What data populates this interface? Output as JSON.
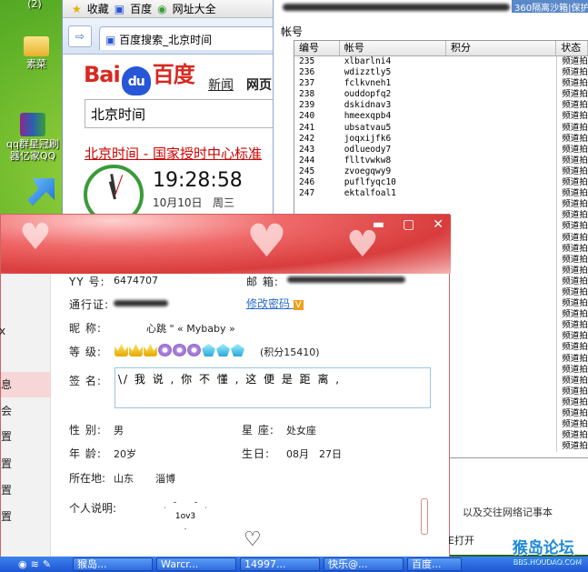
{
  "desktop": {
    "icons": [
      {
        "label": "(2)",
        "top": "-2"
      },
      {
        "label": "素菜"
      },
      {
        "label": "qq群星冠刷器亿家QQ"
      }
    ]
  },
  "browser": {
    "bookmarks": [
      "收藏",
      "百度",
      "网址大全"
    ],
    "tab_title": "百度搜索_北京时间",
    "logo": {
      "bai": "Bai",
      "du": "du",
      "baidu": "百度"
    },
    "nav_news": "新闻",
    "nav_web": "网页",
    "search_value": "北京时间",
    "result_link": "北京时间",
    "result_rest": " - 国家授时中心标准",
    "time": "19:28:58",
    "date": "10月10日",
    "weekday": "周三"
  },
  "accounts": {
    "top_right": "360隔离沙箱|保护",
    "section_title": "帐号",
    "columns": [
      "编号",
      "帐号",
      "积分",
      "状态"
    ],
    "rows": [
      {
        "id": "235",
        "account": "xlbarlni4"
      },
      {
        "id": "236",
        "account": "wdizztly5"
      },
      {
        "id": "237",
        "account": "fclkvneh1"
      },
      {
        "id": "238",
        "account": "ouddopfq2"
      },
      {
        "id": "239",
        "account": "dskidnav3"
      },
      {
        "id": "240",
        "account": "hmeexqpb4"
      },
      {
        "id": "241",
        "account": "ubsatvau5"
      },
      {
        "id": "242",
        "account": "joqxijfk6"
      },
      {
        "id": "243",
        "account": "odlueody7"
      },
      {
        "id": "244",
        "account": "flltvwkw8"
      },
      {
        "id": "245",
        "account": "zvoegqwy9"
      },
      {
        "id": "246",
        "account": "puflfyqc10"
      },
      {
        "id": "247",
        "account": "ektalfoal1"
      }
    ],
    "status_value": "频道拍",
    "bottom_text": "以及交往网络记事本"
  },
  "profile": {
    "yy_label": "YY 号:",
    "yy_value": "6474707",
    "email_label": "邮 箱:",
    "pass_label": "通行证:",
    "modify_password": "修改密码",
    "v_badge": "V",
    "nick_label": "昵 称:",
    "nick_value": "心跳 \" « Mybaby »",
    "level_label": "等 级:",
    "points": "(积分15410)",
    "sign_label": "签 名:",
    "sign_value": "\\/ 我 说 , 你 不 懂 , 这 便 是 距 离 ,",
    "gender_label": "性 别:",
    "gender_value": "男",
    "zodiac_label": "星 座:",
    "zodiac_value": "处女座",
    "age_label": "年 龄:",
    "age_value": "20岁",
    "birthday_label": "生日:",
    "birthday_month": "08月",
    "birthday_day": "27日",
    "location_label": "所在地:",
    "location_province": "山东",
    "location_city": "淄博",
    "intro_label": "个人说明:",
    "heart_text": "1ov3",
    "side_items": [
      "息",
      "会",
      "置",
      "置",
      "置",
      "置"
    ],
    "side_top": "x"
  },
  "taskbar": {
    "items": [
      "猴岛...",
      "Warcr...",
      "14997...",
      "快乐@...",
      "百度..."
    ],
    "open_label": "E打开"
  },
  "watermark": {
    "main": "猴岛论坛",
    "sub": "BBS.HOUDAO.COM"
  }
}
